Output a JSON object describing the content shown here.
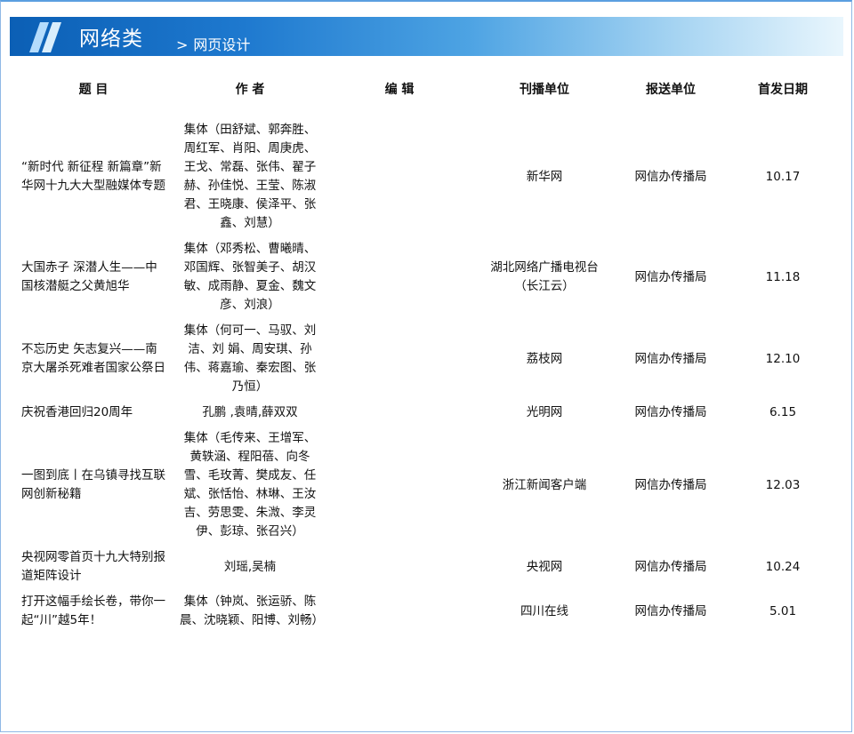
{
  "header": {
    "category": "网络类",
    "subcategory_chevron": ">",
    "subcategory": "网页设计"
  },
  "table": {
    "columns": [
      "题 目",
      "作 者",
      "编 辑",
      "刊播单位",
      "报送单位",
      "首发日期"
    ],
    "rows": [
      {
        "title": "“新时代 新征程 新篇章”新华网十九大大型融媒体专题",
        "author": "集体（田舒斌、郭奔胜、周红军、肖阳、周庚虎、王戈、常磊、张伟、翟子赫、孙佳悦、王莹、陈淑君、王晓康、侯泽平、张鑫、刘慧）",
        "editor": "",
        "publisher": "新华网",
        "submitter": "网信办传播局",
        "date": "10.17"
      },
      {
        "title": "大国赤子 深潜人生——中国核潜艇之父黄旭华",
        "author": "集体（邓秀松、曹曦晴、邓国辉、张智美子、胡汉敏、成雨静、夏金、魏文彦、刘浪）",
        "editor": "",
        "publisher": "湖北网络广播电视台（长江云）",
        "submitter": "网信办传播局",
        "date": "11.18"
      },
      {
        "title": "不忘历史 矢志复兴——南京大屠杀死难者国家公祭日",
        "author": "集体（何可一、马驭、刘 洁、刘 娟、周安琪、孙 伟、蒋嘉瑜、秦宏图、张乃恒）",
        "editor": "",
        "publisher": "荔枝网",
        "submitter": "网信办传播局",
        "date": "12.10"
      },
      {
        "title": "庆祝香港回归20周年",
        "author": "孔鹏 ,袁晴,薛双双",
        "editor": "",
        "publisher": "光明网",
        "submitter": "网信办传播局",
        "date": "6.15"
      },
      {
        "title": "一图到底丨在乌镇寻找互联网创新秘籍",
        "author": "集体（毛传来、王增军、黄轶涵、程阳蓓、向冬雪、毛玫菁、樊成友、任斌、张恬怡、林琳、王汝吉、劳思雯、朱溦、李灵伊、彭琼、张召兴）",
        "editor": "",
        "publisher": "浙江新闻客户端",
        "submitter": "网信办传播局",
        "date": "12.03"
      },
      {
        "title": "央视网零首页十九大特别报道矩阵设计",
        "author": "刘瑶,吴楠",
        "editor": "",
        "publisher": "央视网",
        "submitter": "网信办传播局",
        "date": "10.24"
      },
      {
        "title": "打开这幅手绘长卷，带你一起“川”越5年！",
        "author": "集体（钟岚、张运骄、陈晨、沈晓颖、阳博、刘畅）",
        "editor": "",
        "publisher": "四川在线",
        "submitter": "网信办传播局",
        "date": "5.01"
      }
    ]
  },
  "colors": {
    "banner_start": "#0b5fb5",
    "banner_end": "#e9f6fd",
    "frame_border": "#8fb8e6"
  }
}
